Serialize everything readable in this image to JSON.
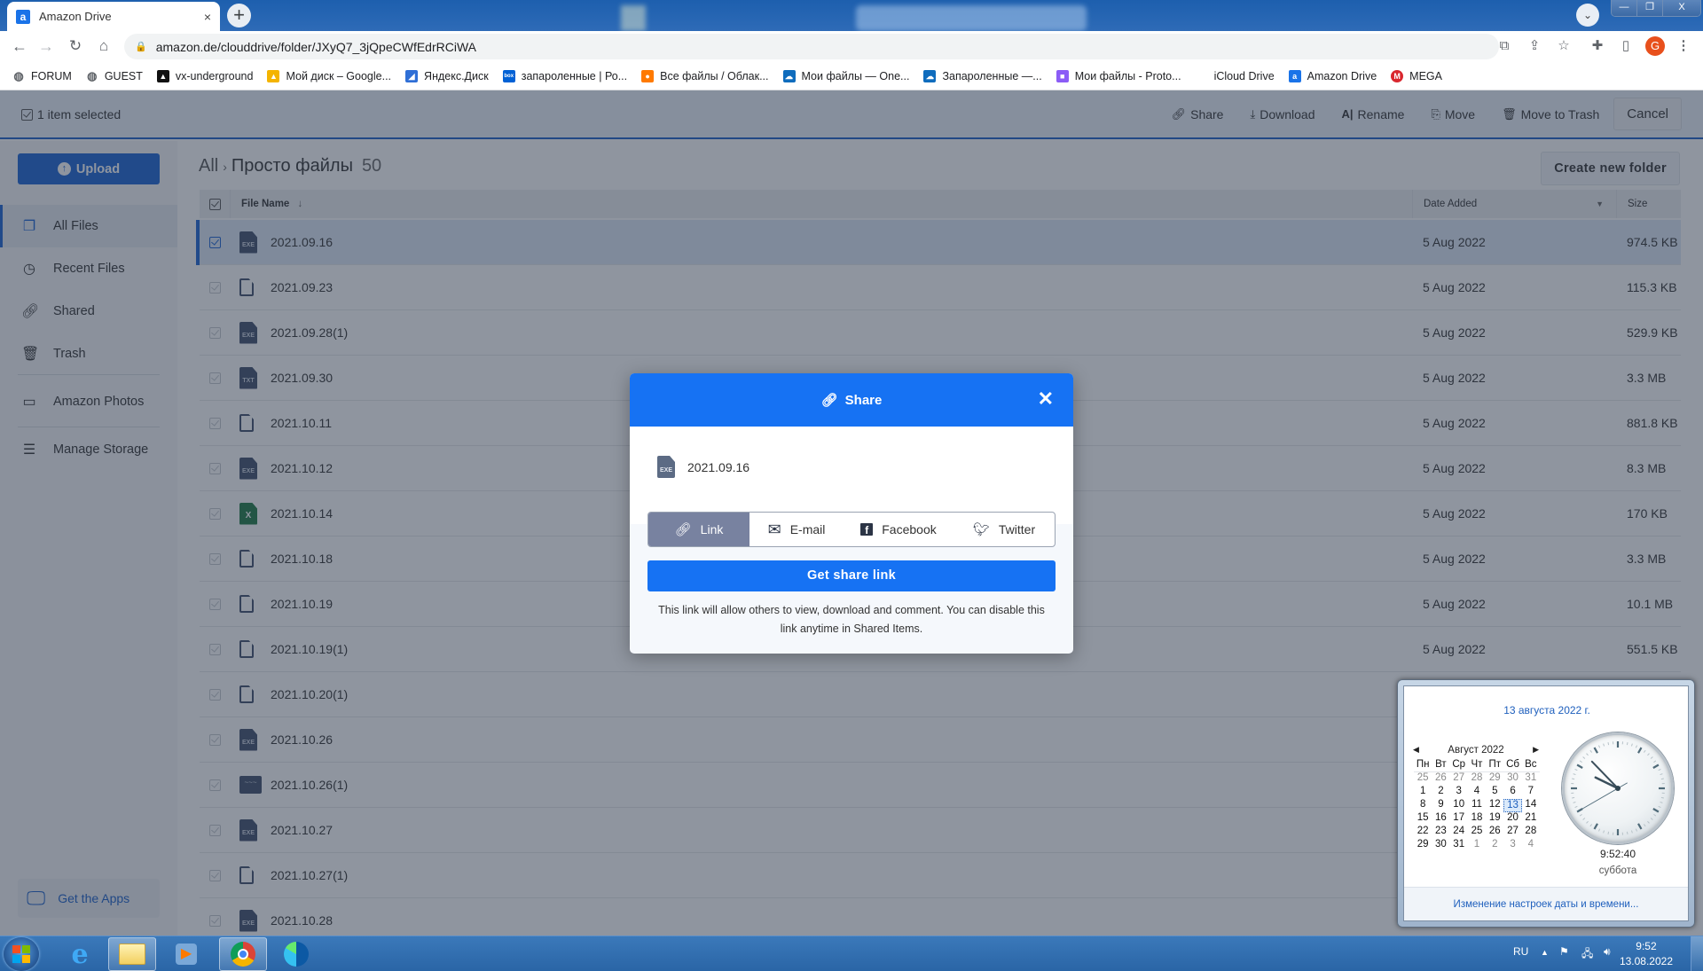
{
  "browser": {
    "tab_title": "Amazon Drive",
    "tab_close": "×",
    "new_tab": "+",
    "url": "amazon.de/clouddrive/folder/JXyQ7_3jQpeCWfEdrRCiWA",
    "profile_initial": "G",
    "window_controls": [
      "—",
      "❐",
      "X"
    ],
    "bookmarks": [
      {
        "label": "FORUM",
        "icon": "globe-icon",
        "color": "#5f6368"
      },
      {
        "label": "GUEST",
        "icon": "globe-icon",
        "color": "#5f6368"
      },
      {
        "label": "vx-underground",
        "icon": "vx-icon",
        "color": "#111111"
      },
      {
        "label": "Мой диск – Google...",
        "icon": "google-drive-icon",
        "color": "#f4b400"
      },
      {
        "label": "Яндекс.Диск",
        "icon": "yandex-disk-icon",
        "color": "#2f6fd6"
      },
      {
        "label": "запароленные | Ро...",
        "icon": "box-icon",
        "color": "#0061d5"
      },
      {
        "label": "Все файлы / Облак...",
        "icon": "mailru-cloud-icon",
        "color": "#ff7a00"
      },
      {
        "label": "Мои файлы — One...",
        "icon": "onedrive-icon",
        "color": "#0f6cbd"
      },
      {
        "label": "Запароленные —...",
        "icon": "onedrive-icon",
        "color": "#0f6cbd"
      },
      {
        "label": "Мои файлы - Proto...",
        "icon": "protondrive-icon",
        "color": "#8b5cf6"
      },
      {
        "label": "iCloud Drive",
        "icon": "apple-icon",
        "color": "#777777"
      },
      {
        "label": "Amazon Drive",
        "icon": "amazon-icon",
        "color": "#1a73e8"
      },
      {
        "label": "MEGA",
        "icon": "mega-icon",
        "color": "#d9272e"
      }
    ]
  },
  "toolbar": {
    "selected_label": "1 item selected",
    "actions": [
      {
        "label": "Share",
        "icon": "link-icon"
      },
      {
        "label": "Download",
        "icon": "download-icon"
      },
      {
        "label": "Rename",
        "icon": "rename-icon"
      },
      {
        "label": "Move",
        "icon": "move-icon"
      },
      {
        "label": "Move to Trash",
        "icon": "trash-icon"
      }
    ],
    "cancel_label": "Cancel"
  },
  "sidebar": {
    "upload_label": "Upload",
    "items": [
      {
        "label": "All Files",
        "icon": "files-icon",
        "active": true
      },
      {
        "label": "Recent Files",
        "icon": "clock-icon"
      },
      {
        "label": "Shared",
        "icon": "link-icon"
      },
      {
        "label": "Trash",
        "icon": "trash-icon"
      },
      {
        "label": "Amazon Photos",
        "icon": "photos-icon"
      },
      {
        "label": "Manage Storage",
        "icon": "storage-icon"
      }
    ],
    "get_apps_label": "Get the Apps"
  },
  "main": {
    "breadcrumb_root": "All",
    "breadcrumb_sep": "›",
    "folder_name": "Просто файлы",
    "item_count": "50",
    "create_folder_label": "Create new folder",
    "columns": {
      "name": "File Name",
      "sort_arrow": "↓",
      "date": "Date Added",
      "date_caret": "▼",
      "size": "Size"
    },
    "files": [
      {
        "name": "2021.09.16",
        "type": "exe",
        "date": "5 Aug 2022",
        "size": "974.5 KB",
        "selected": true
      },
      {
        "name": "2021.09.23",
        "type": "doc",
        "date": "5 Aug 2022",
        "size": "115.3 KB"
      },
      {
        "name": "2021.09.28(1)",
        "type": "exe",
        "date": "5 Aug 2022",
        "size": "529.9 KB"
      },
      {
        "name": "2021.09.30",
        "type": "txt",
        "date": "5 Aug 2022",
        "size": "3.3 MB"
      },
      {
        "name": "2021.10.11",
        "type": "doc",
        "date": "5 Aug 2022",
        "size": "881.8 KB"
      },
      {
        "name": "2021.10.12",
        "type": "exe",
        "date": "5 Aug 2022",
        "size": "8.3 MB"
      },
      {
        "name": "2021.10.14",
        "type": "xls",
        "date": "5 Aug 2022",
        "size": "170 KB"
      },
      {
        "name": "2021.10.18",
        "type": "doc",
        "date": "5 Aug 2022",
        "size": "3.3 MB"
      },
      {
        "name": "2021.10.19",
        "type": "doc",
        "date": "5 Aug 2022",
        "size": "10.1 MB"
      },
      {
        "name": "2021.10.19(1)",
        "type": "doc",
        "date": "5 Aug 2022",
        "size": "551.5 KB"
      },
      {
        "name": "2021.10.20(1)",
        "type": "doc",
        "date": "",
        "size": ""
      },
      {
        "name": "2021.10.26",
        "type": "exe",
        "date": "",
        "size": ""
      },
      {
        "name": "2021.10.26(1)",
        "type": "zip",
        "date": "",
        "size": ""
      },
      {
        "name": "2021.10.27",
        "type": "exe",
        "date": "",
        "size": ""
      },
      {
        "name": "2021.10.27(1)",
        "type": "doc",
        "date": "",
        "size": ""
      },
      {
        "name": "2021.10.28",
        "type": "exe",
        "date": "",
        "size": ""
      }
    ]
  },
  "share_modal": {
    "title": "Share",
    "close": "✕",
    "file_name": "2021.09.16",
    "file_badge": "EXE",
    "tabs": [
      {
        "label": "Link",
        "icon": "link-icon",
        "active": true
      },
      {
        "label": "E-mail",
        "icon": "email-icon"
      },
      {
        "label": "Facebook",
        "icon": "facebook-icon"
      },
      {
        "label": "Twitter",
        "icon": "twitter-icon"
      }
    ],
    "get_link_label": "Get share link",
    "note": "This link will allow others to view, download and comment. You can disable this link anytime in Shared Items."
  },
  "calendar": {
    "full_date": "13 августа 2022 г.",
    "month_label": "Август 2022",
    "prev": "◀",
    "next": "▶",
    "weekdays": [
      "Пн",
      "Вт",
      "Ср",
      "Чт",
      "Пт",
      "Сб",
      "Вс"
    ],
    "weeks": [
      [
        "25",
        "26",
        "27",
        "28",
        "29",
        "30",
        "31"
      ],
      [
        "1",
        "2",
        "3",
        "4",
        "5",
        "6",
        "7"
      ],
      [
        "8",
        "9",
        "10",
        "11",
        "12",
        "13",
        "14"
      ],
      [
        "15",
        "16",
        "17",
        "18",
        "19",
        "20",
        "21"
      ],
      [
        "22",
        "23",
        "24",
        "25",
        "26",
        "27",
        "28"
      ],
      [
        "29",
        "30",
        "31",
        "1",
        "2",
        "3",
        "4"
      ]
    ],
    "today": "13",
    "time": "9:52:40",
    "day_name": "суббота",
    "settings_link": "Изменение настроек даты и времени...",
    "clock": {
      "hours": 9,
      "minutes": 52,
      "seconds": 40
    }
  },
  "taskbar": {
    "apps": [
      {
        "name": "internet-explorer",
        "open": false
      },
      {
        "name": "file-explorer",
        "open": true
      },
      {
        "name": "media-player",
        "open": false
      },
      {
        "name": "chrome",
        "open": true
      },
      {
        "name": "edge",
        "open": false
      }
    ],
    "language": "RU",
    "time": "9:52",
    "date": "13.08.2022"
  }
}
